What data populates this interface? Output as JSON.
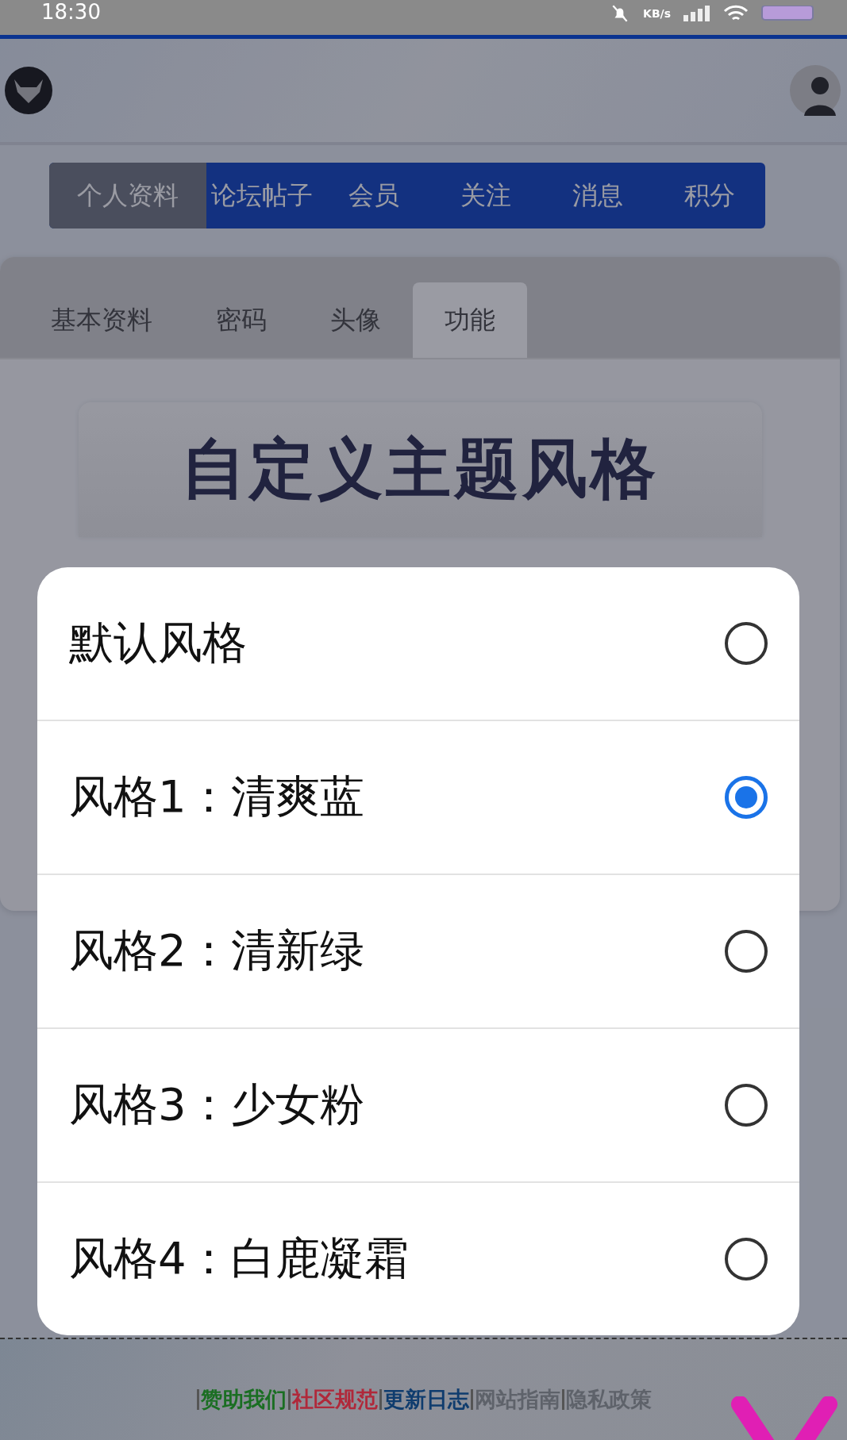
{
  "status_bar": {
    "time": "18:30",
    "speed_unit": "KB/s"
  },
  "nav_tabs": [
    {
      "label": "个人资料",
      "selected": true
    },
    {
      "label": "论坛帖子",
      "selected": false
    },
    {
      "label": "会员",
      "selected": false
    },
    {
      "label": "关注",
      "selected": false
    },
    {
      "label": "消息",
      "selected": false
    },
    {
      "label": "积分",
      "selected": false
    }
  ],
  "sub_tabs": [
    {
      "label": "基本资料",
      "selected": false
    },
    {
      "label": "密码",
      "selected": false
    },
    {
      "label": "头像",
      "selected": false
    },
    {
      "label": "功能",
      "selected": true
    }
  ],
  "card": {
    "title": "自定义主题风格"
  },
  "theme_dialog": {
    "options": [
      {
        "label": "默认风格",
        "selected": false
      },
      {
        "label": "风格1：清爽蓝",
        "selected": true
      },
      {
        "label": "风格2：清新绿",
        "selected": false
      },
      {
        "label": "风格3：少女粉",
        "selected": false
      },
      {
        "label": "风格4：白鹿凝霜",
        "selected": false
      }
    ]
  },
  "footer_links": [
    {
      "label": "赞助我们",
      "color": "#1a6e22"
    },
    {
      "label": "社区规范",
      "color": "#b0283a"
    },
    {
      "label": "更新日志",
      "color": "#0f3c6e"
    },
    {
      "label": "网站指南",
      "color": "#5e626a"
    },
    {
      "label": "隐私政策",
      "color": "#5e626a"
    }
  ]
}
